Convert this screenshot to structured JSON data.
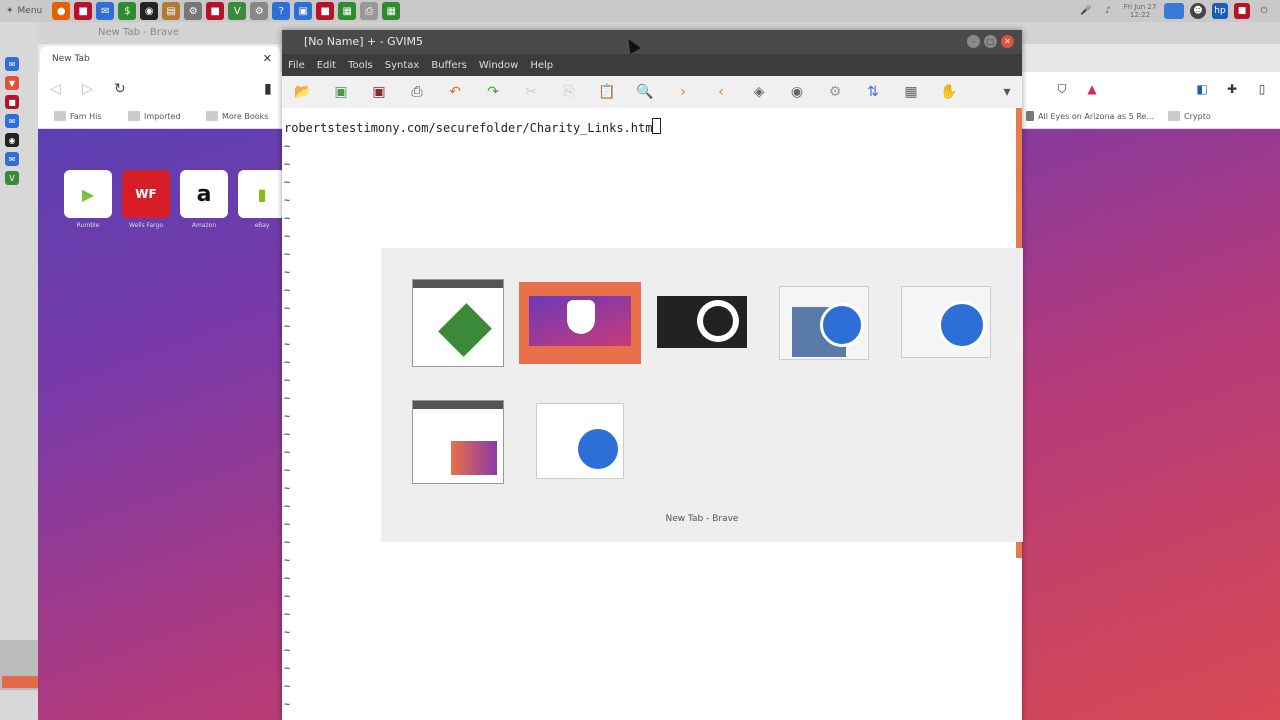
{
  "top_panel": {
    "menu_label": "Menu",
    "clock": "Fri Jun 27\n12:22"
  },
  "brave": {
    "window_title": "New Tab - Brave",
    "tab_title": "New Tab",
    "bookmarks": [
      "Fam His",
      "Imported",
      "More Books",
      "All Eyes on Arizona as 5 Re...",
      "Crypto"
    ],
    "tiles": [
      {
        "label": "Rumble",
        "glyph": "▶",
        "color": "#7bc043"
      },
      {
        "label": "Wells Fargo",
        "glyph": "WF",
        "color": "#d71e28"
      },
      {
        "label": "Amazon",
        "glyph": "a",
        "color": "#111111"
      },
      {
        "label": "eBay",
        "glyph": "▮",
        "color": "#86b817"
      }
    ]
  },
  "gvim": {
    "window_title": "[No Name] + - GVIM5",
    "menus": [
      "File",
      "Edit",
      "Tools",
      "Syntax",
      "Buffers",
      "Window",
      "Help"
    ],
    "buffer_line": "robertstestimony.com/securefolder/Charity_Links.htm",
    "tilde": "~"
  },
  "switcher": {
    "selected_label": "New Tab - Brave",
    "items": [
      "gvim",
      "brave",
      "obs",
      "thunderbird-match",
      "thunderbird",
      "files",
      "thunderbird-compose"
    ]
  },
  "colors": {
    "accent": "#e47a4e",
    "close": "#e0523a",
    "tilde": "#3a3ad8"
  }
}
